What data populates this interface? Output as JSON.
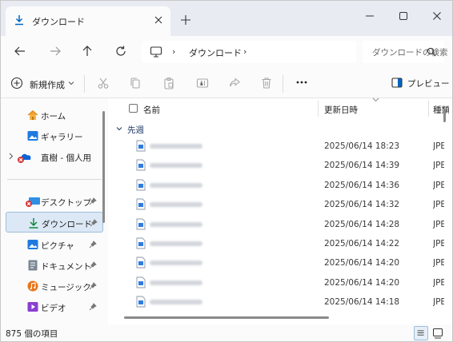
{
  "window": {
    "tab_title": "ダウンロード",
    "new_tab_glyph": "+",
    "close_tab_glyph": "×"
  },
  "address": {
    "crumb": "ダウンロード",
    "separator": "›",
    "search_placeholder": "ダウンロードの検索"
  },
  "toolbar": {
    "new_label": "新規作成",
    "more_label": "···",
    "preview_label": "プレビュー"
  },
  "sidebar": {
    "items": [
      {
        "label": "ホーム",
        "icon": "home-icon"
      },
      {
        "label": "ギャラリー",
        "icon": "gallery-icon"
      },
      {
        "label": "直樹 - 個人用",
        "icon": "onedrive-icon"
      },
      {
        "label": "デスクトップ",
        "icon": "desktop-icon"
      },
      {
        "label": "ダウンロード",
        "icon": "download-icon"
      },
      {
        "label": "ピクチャ",
        "icon": "pictures-icon"
      },
      {
        "label": "ドキュメント",
        "icon": "documents-icon"
      },
      {
        "label": "ミュージック",
        "icon": "music-icon"
      },
      {
        "label": "ビデオ",
        "icon": "videos-icon"
      }
    ]
  },
  "list": {
    "col_name": "名前",
    "col_date": "更新日時",
    "col_type": "種類",
    "group_label": "先週",
    "rows": [
      {
        "date": "2025/06/14 18:23",
        "type": "JPEG"
      },
      {
        "date": "2025/06/14 14:39",
        "type": "JPEG"
      },
      {
        "date": "2025/06/14 14:36",
        "type": "JPEG"
      },
      {
        "date": "2025/06/14 14:32",
        "type": "JPEG"
      },
      {
        "date": "2025/06/14 14:28",
        "type": "JPEG"
      },
      {
        "date": "2025/06/14 14:22",
        "type": "JPEG"
      },
      {
        "date": "2025/06/14 14:20",
        "type": "JPEG"
      },
      {
        "date": "2025/06/14 14:20",
        "type": "JPEG"
      },
      {
        "date": "2025/06/14 14:18",
        "type": "JPEG"
      }
    ]
  },
  "status": {
    "item_count": "875 個の項目"
  },
  "colors": {
    "accent": "#0067c0",
    "selected_bg": "#dce8f5",
    "titlebar_bg": "#e8ecf2"
  }
}
